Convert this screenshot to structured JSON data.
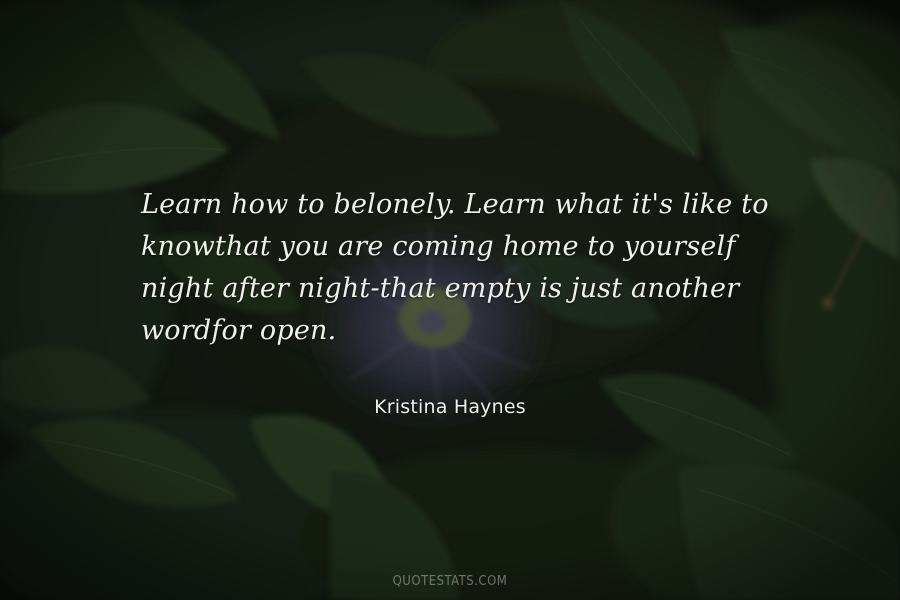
{
  "quote": {
    "lines": [
      "Learn how to belonely. Learn what it's like to",
      "knowthat you are coming home to yourself",
      "night after night-that empty is just another",
      "wordfor open."
    ]
  },
  "author": "Kristina Haynes",
  "watermark": "QUOTESTATS.COM",
  "colors": {
    "background": "#151c13",
    "leaf_dark": "#1d2a19",
    "leaf_mid": "#2b3c25",
    "flower": "#3a3d5e",
    "text": "#f1f1ec"
  }
}
